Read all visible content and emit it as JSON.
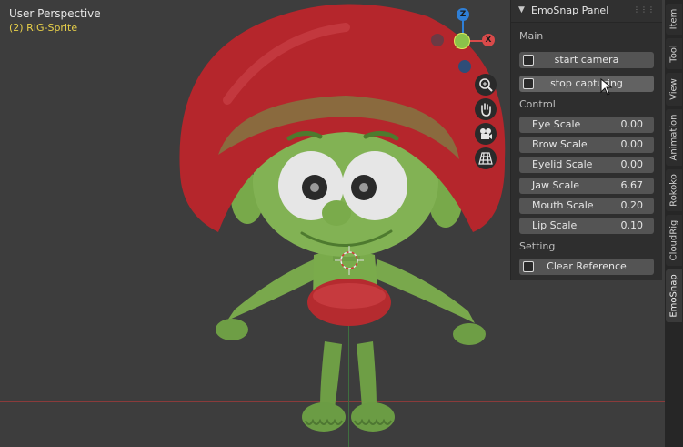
{
  "viewport": {
    "title": "User Perspective",
    "object_label": "(2) RIG-Sprite"
  },
  "gizmo": {
    "z_label": "Z",
    "x_label": "X",
    "colors": {
      "z": "#2f7fd6",
      "x": "#d94a4a",
      "y": "#8bc34a"
    }
  },
  "nav_buttons": [
    "zoom-icon",
    "hand-pan-icon",
    "camera-icon",
    "grid-perspective-icon"
  ],
  "panel": {
    "title": "EmoSnap Panel",
    "sections": {
      "main": "Main",
      "control": "Control",
      "setting": "Setting"
    },
    "buttons": {
      "start_camera": "start camera",
      "stop_capturing": "stop capturing",
      "clear_reference": "Clear Reference"
    },
    "fields": [
      {
        "label": "Eye Scale",
        "value": "0.00"
      },
      {
        "label": "Brow Scale",
        "value": "0.00"
      },
      {
        "label": "Eyelid Scale",
        "value": "0.00"
      },
      {
        "label": "Jaw Scale",
        "value": "6.67"
      },
      {
        "label": "Mouth Scale",
        "value": "0.20"
      },
      {
        "label": "Lip Scale",
        "value": "0.10"
      }
    ]
  },
  "tabs": [
    "Item",
    "Tool",
    "View",
    "Animation",
    "Rokoko",
    "CloudRig",
    "EmoSnap"
  ],
  "active_tab": "EmoSnap"
}
